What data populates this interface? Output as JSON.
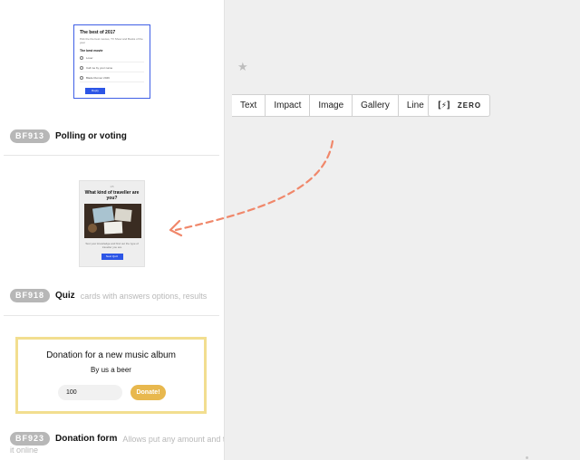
{
  "toolbar": {
    "buttons": [
      "Text",
      "Impact",
      "Image",
      "Gallery",
      "Line"
    ],
    "zero_label": "ZERO",
    "zero_icon": "zero-block-icon",
    "star_icon": "star-icon"
  },
  "blocks": [
    {
      "badge": "BF913",
      "name": "Polling or voting",
      "description": "",
      "preview": {
        "title": "The best of 2017",
        "subtitle": "Pick the the best movies, TV Show and Books of the year",
        "question": "The best movie",
        "options": [
          "Loser",
          "Call me by your name",
          "Blade Runner 2049"
        ],
        "button": "Reply"
      }
    },
    {
      "badge": "BF918",
      "name": "Quiz",
      "description": "cards with answers options, results",
      "preview": {
        "step": "1/5",
        "title": "What kind of traveller are you?",
        "text": "Test your knowledge and find out the type of traveller you are",
        "button": "Next Quiz"
      }
    },
    {
      "badge": "BF923",
      "name": "Donation form",
      "description": "Allows put any amount and take",
      "description_wrap": "it online",
      "preview": {
        "title": "Donation for a new music album",
        "subtitle": "By us a beer",
        "amount": "100",
        "button": "Donate!"
      }
    }
  ],
  "colors": {
    "accent_blue": "#2d56e6",
    "donate_yellow": "#e8b84e",
    "arrow_orange": "#f0876a"
  }
}
